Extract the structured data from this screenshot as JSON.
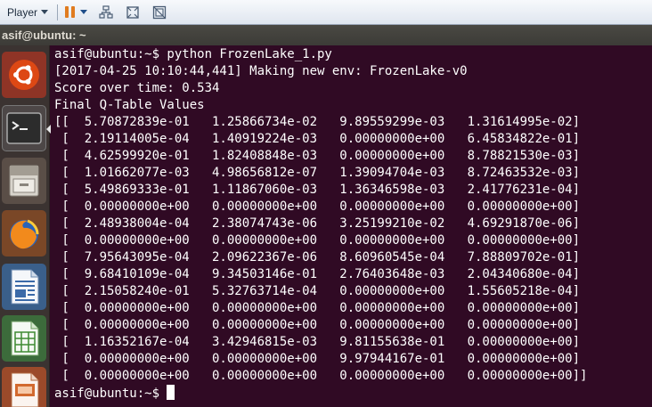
{
  "vm_toolbar": {
    "player_label": "Player",
    "icons": [
      "pause-icon",
      "send-ctrl-alt-del-icon",
      "fullscreen-icon",
      "unity-mode-icon"
    ]
  },
  "terminal": {
    "title": "asif@ubuntu: ~",
    "lines": [
      "asif@ubuntu:~$ python FrozenLake_1.py",
      "[2017-04-25 10:10:44,441] Making new env: FrozenLake-v0",
      "Score over time: 0.534",
      "Final Q-Table Values",
      "[[  5.70872839e-01   1.25866734e-02   9.89559299e-03   1.31614995e-02]",
      " [  2.19114005e-04   1.40919224e-03   0.00000000e+00   6.45834822e-01]",
      " [  4.62599920e-01   1.82408848e-03   0.00000000e+00   8.78821530e-03]",
      " [  1.01662077e-03   4.98656812e-07   1.39094704e-03   8.72463532e-03]",
      " [  5.49869333e-01   1.11867060e-03   1.36346598e-03   2.41776231e-04]",
      " [  0.00000000e+00   0.00000000e+00   0.00000000e+00   0.00000000e+00]",
      " [  2.48938004e-04   2.38074743e-06   3.25199210e-02   4.69291870e-06]",
      " [  0.00000000e+00   0.00000000e+00   0.00000000e+00   0.00000000e+00]",
      " [  7.95643095e-04   2.09622367e-06   8.60960545e-04   7.88809702e-01]",
      " [  9.68410109e-04   9.34503146e-01   2.76403648e-03   2.04340680e-04]",
      " [  2.15058240e-01   5.32763714e-04   0.00000000e+00   1.55605218e-04]",
      " [  0.00000000e+00   0.00000000e+00   0.00000000e+00   0.00000000e+00]",
      " [  0.00000000e+00   0.00000000e+00   0.00000000e+00   0.00000000e+00]",
      " [  1.16352167e-04   3.42946815e-03   9.81155638e-01   0.00000000e+00]",
      " [  0.00000000e+00   0.00000000e+00   9.97944167e-01   0.00000000e+00]",
      " [  0.00000000e+00   0.00000000e+00   0.00000000e+00   0.00000000e+00]]"
    ],
    "prompt": "asif@ubuntu:~$ "
  },
  "launcher": {
    "items": [
      "ubuntu-dash-icon",
      "terminal-icon",
      "files-icon",
      "firefox-icon",
      "libreoffice-writer-icon",
      "libreoffice-calc-icon",
      "libreoffice-impress-icon"
    ]
  },
  "colors": {
    "terminal_bg": "#300a24",
    "terminal_fg": "#ffffff",
    "titlebar_bg": "#3c3b37",
    "launcher_bg": "#3b3331"
  }
}
